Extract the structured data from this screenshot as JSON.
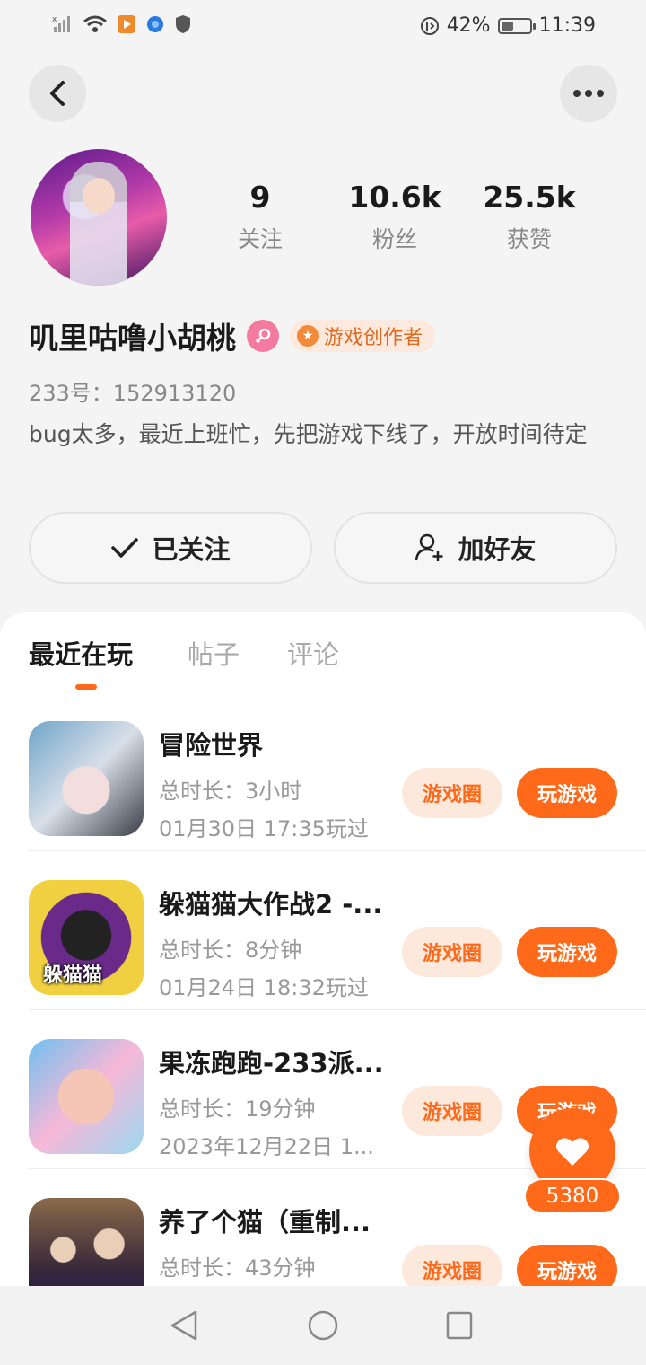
{
  "status_bar": {
    "battery": "42%",
    "battery_level": 0.42,
    "time": "11:39"
  },
  "profile": {
    "stats": [
      {
        "value": "9",
        "label": "关注"
      },
      {
        "value": "10.6k",
        "label": "粉丝"
      },
      {
        "value": "25.5k",
        "label": "获赞"
      }
    ],
    "nickname": "叽里咕噜小胡桃",
    "creator_badge": "游戏创作者",
    "uid": "233号：152913120",
    "bio": "bug太多，最近上班忙，先把游戏下线了，开放时间待定",
    "follow_button": "已关注",
    "add_friend_button": "加好友"
  },
  "tabs": [
    "最近在玩",
    "帖子",
    "评论"
  ],
  "games": [
    {
      "name": "冒险世界",
      "duration": "总时长：3小时",
      "last_played": "01月30日 17:35玩过",
      "icon_label": ""
    },
    {
      "name": "躲猫猫大作战2 -...",
      "duration": "总时长：8分钟",
      "last_played": "01月24日 18:32玩过",
      "icon_label": "躲猫猫"
    },
    {
      "name": "果冻跑跑-233派...",
      "duration": "总时长：19分钟",
      "last_played": "2023年12月22日 1...",
      "icon_label": ""
    },
    {
      "name": "养了个猫（重制...",
      "duration": "总时长：43分钟",
      "last_played": "",
      "icon_label": ""
    }
  ],
  "game_buttons": {
    "circle": "游戏圈",
    "play": "玩游戏"
  },
  "floating_like": {
    "count": "5380"
  },
  "colors": {
    "accent": "#ff6a1a",
    "accent_light": "#fde8dc",
    "background": "#f4f4f4"
  }
}
